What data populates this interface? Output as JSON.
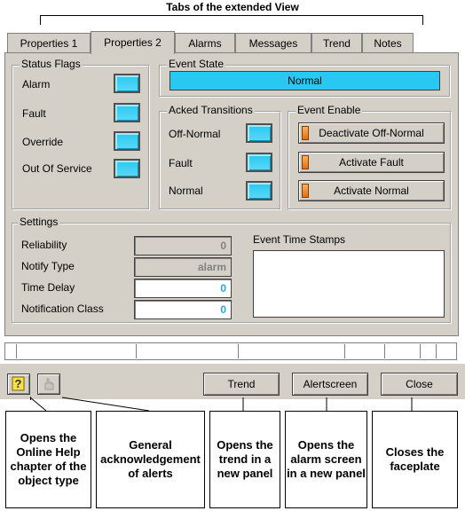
{
  "caption": "Tabs of the extended View",
  "tabs": [
    "Properties 1",
    "Properties 2",
    "Alarms",
    "Messages",
    "Trend",
    "Notes"
  ],
  "active_tab": "Properties 2",
  "status_flags": {
    "legend": "Status Flags",
    "items": [
      "Alarm",
      "Fault",
      "Override",
      "Out Of Service"
    ]
  },
  "event_state": {
    "legend": "Event State",
    "value": "Normal",
    "color": "#28c8f0"
  },
  "acked_transitions": {
    "legend": "Acked Transitions",
    "items": [
      "Off-Normal",
      "Fault",
      "Normal"
    ]
  },
  "event_enable": {
    "legend": "Event Enable",
    "buttons": [
      "Deactivate Off-Normal",
      "Activate Fault",
      "Activate Normal"
    ]
  },
  "settings": {
    "legend": "Settings",
    "reliability_label": "Reliability",
    "reliability_value": "0",
    "notify_type_label": "Notify Type",
    "notify_type_value": "alarm",
    "time_delay_label": "Time Delay",
    "time_delay_value": "0",
    "notification_class_label": "Notification Class",
    "notification_class_value": "0",
    "timestamps_label": "Event Time Stamps"
  },
  "bottom_buttons": {
    "trend": "Trend",
    "alertscreen": "Alertscreen",
    "close": "Close"
  },
  "icons": {
    "help": "help-icon",
    "acknowledge": "acknowledge-hand-icon"
  },
  "annotations": [
    "Opens the Online Help chapter of the object type",
    "General acknowledgement of alerts",
    "Opens the trend in a new panel",
    "Opens the alarm screen in a new panel",
    "Closes the faceplate"
  ],
  "colors": {
    "led": "#28c8f0",
    "panel": "#d4d0c8",
    "value_blue": "#2aa8e0",
    "indicator_orange": "#f08020"
  }
}
